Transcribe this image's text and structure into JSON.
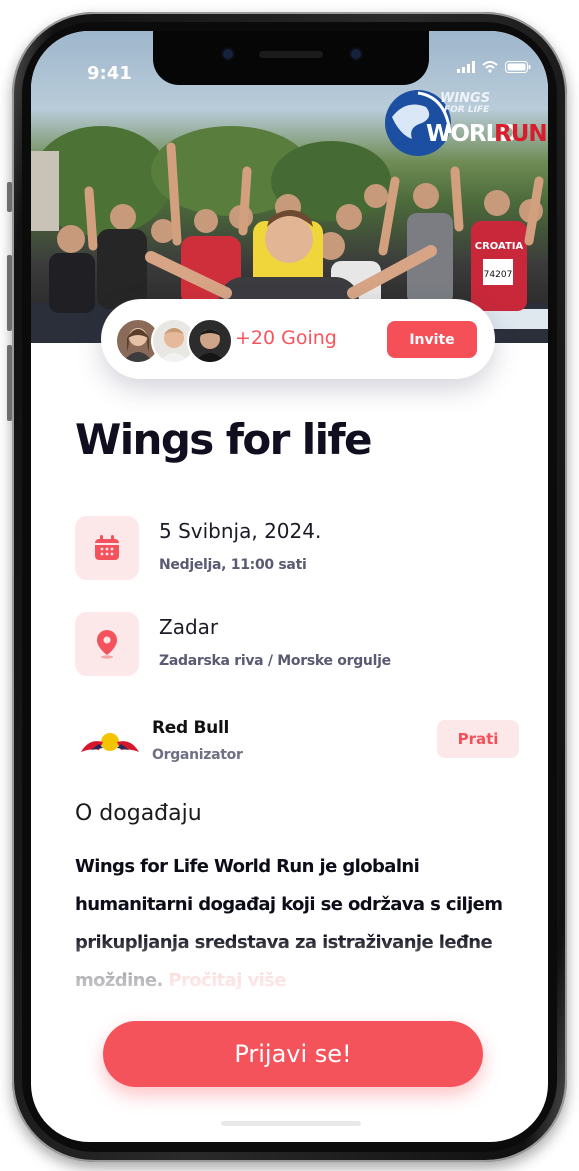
{
  "status_bar": {
    "time": "9:41"
  },
  "hero": {
    "logo_top": "WINGS",
    "logo_middle": "FOR LIFE",
    "logo_world": "WORLD",
    "logo_run": "RUN",
    "shirt_text": "CROATIA",
    "bib_number": "74207"
  },
  "attendees": {
    "going_text": "+20 Going",
    "invite_label": "Invite"
  },
  "event": {
    "title": "Wings for life",
    "date": "5 Svibnja, 2024.",
    "time": "Nedjelja, 11:00 sati",
    "city": "Zadar",
    "venue": "Zadarska riva / Morske orgulje"
  },
  "organizer": {
    "name": "Red Bull",
    "role": "Organizator",
    "follow_label": "Prati"
  },
  "about": {
    "heading": "O događaju",
    "text": "Wings for Life World Run je globalni humanitarni događaj koji se održava s ciljem prikupljanja sredstava za istraživanje leđne moždine.",
    "read_more": "Pročitaj više"
  },
  "cta": {
    "label": "Prijavi se!"
  },
  "colors": {
    "accent": "#f5535b",
    "accent_soft": "#fde8e9",
    "title": "#110f1f"
  },
  "icons": [
    "calendar-icon",
    "location-pin-icon",
    "signal-icon",
    "wifi-icon",
    "battery-icon",
    "red-bull-logo"
  ]
}
